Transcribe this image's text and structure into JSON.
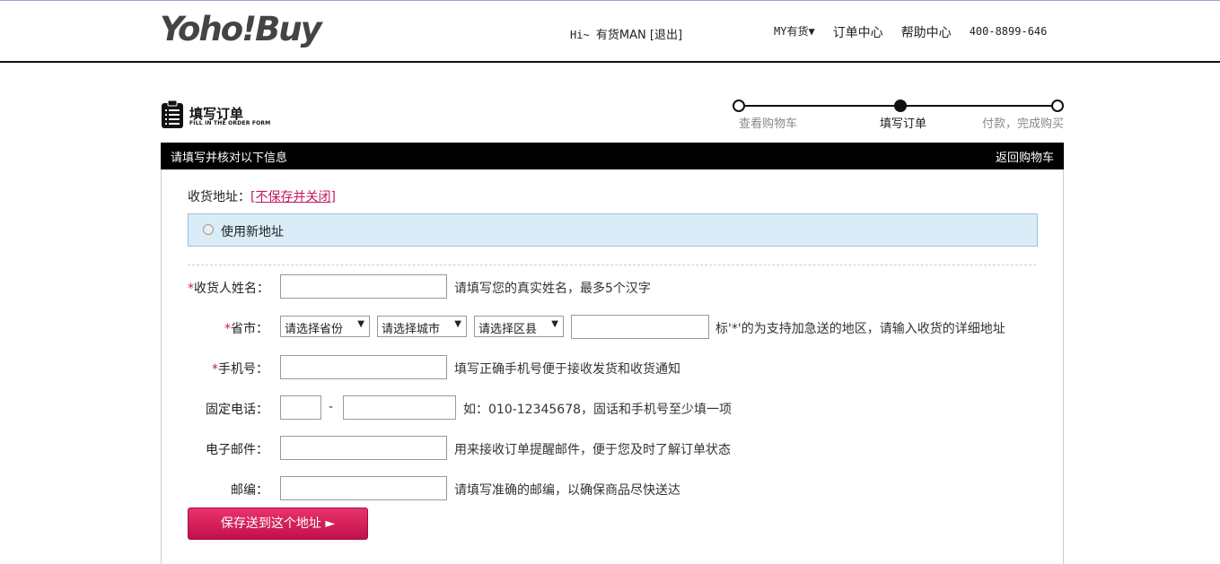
{
  "header": {
    "logo": "Yoho!Buy",
    "greeting_prefix": "Hi~ ",
    "username": "有货MAN",
    "logout": "[退出]",
    "nav_my": "MY有货▼",
    "nav_orders": "订单中心",
    "nav_help": "帮助中心",
    "phone": "400-8899-646"
  },
  "title": {
    "cn": "填写订单",
    "en": "FILL IN THE ORDER FORM"
  },
  "steps": [
    {
      "label": "查看购物车",
      "active": false
    },
    {
      "label": "填写订单",
      "active": true
    },
    {
      "label": "付款，完成购买",
      "active": false
    }
  ],
  "bar": {
    "left": "请填写并核对以下信息",
    "right": "返回购物车"
  },
  "address": {
    "label": "收货地址：",
    "close_link": "[不保存并关闭]",
    "new_option": "使用新地址"
  },
  "form": {
    "name_label": "收货人姓名：",
    "name_hint": "请填写您的真实姓名，最多5个汉字",
    "region_label": "省市：",
    "province_select": "请选择省份",
    "city_select": "请选择城市",
    "district_select": "请选择区县",
    "region_hint": "标'*'的为支持加急送的地区，请输入收货的详细地址",
    "mobile_label": "手机号：",
    "mobile_hint": "填写正确手机号便于接收发货和收货通知",
    "phone_label": "固定电话：",
    "phone_sep": "-",
    "phone_hint": "如：010-12345678，固话和手机号至少填一项",
    "email_label": "电子邮件：",
    "email_hint": "用来接收订单提醒邮件，便于您及时了解订单状态",
    "zip_label": "邮编：",
    "zip_hint": "请填写准确的邮编，以确保商品尽快送达",
    "required_mark": "*"
  },
  "save_button": "保存送到这个地址  ►"
}
